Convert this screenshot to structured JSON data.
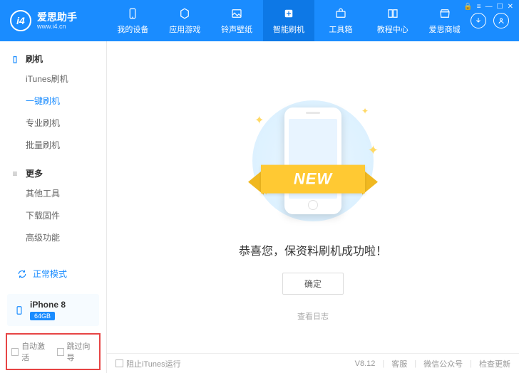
{
  "brand": {
    "name": "爱思助手",
    "site": "www.i4.cn"
  },
  "nav": {
    "items": [
      {
        "label": "我的设备"
      },
      {
        "label": "应用游戏"
      },
      {
        "label": "铃声壁纸"
      },
      {
        "label": "智能刷机"
      },
      {
        "label": "工具箱"
      },
      {
        "label": "教程中心"
      },
      {
        "label": "爱思商城"
      }
    ],
    "active_index": 3
  },
  "sidebar": {
    "sections": [
      {
        "title": "刷机",
        "items": [
          "iTunes刷机",
          "一键刷机",
          "专业刷机",
          "批量刷机"
        ],
        "active_index": 1
      },
      {
        "title": "更多",
        "items": [
          "其他工具",
          "下载固件",
          "高级功能"
        ]
      }
    ],
    "mode": "正常模式",
    "device": {
      "name": "iPhone 8",
      "storage": "64GB"
    },
    "checks": {
      "auto_activate": "自动激活",
      "skip_guide": "跳过向导"
    }
  },
  "main": {
    "ribbon": "NEW",
    "success": "恭喜您，保资料刷机成功啦！",
    "ok": "确定",
    "view_log": "查看日志"
  },
  "footer": {
    "block_itunes": "阻止iTunes运行",
    "version": "V8.12",
    "service": "客服",
    "wechat": "微信公众号",
    "update": "检查更新"
  }
}
